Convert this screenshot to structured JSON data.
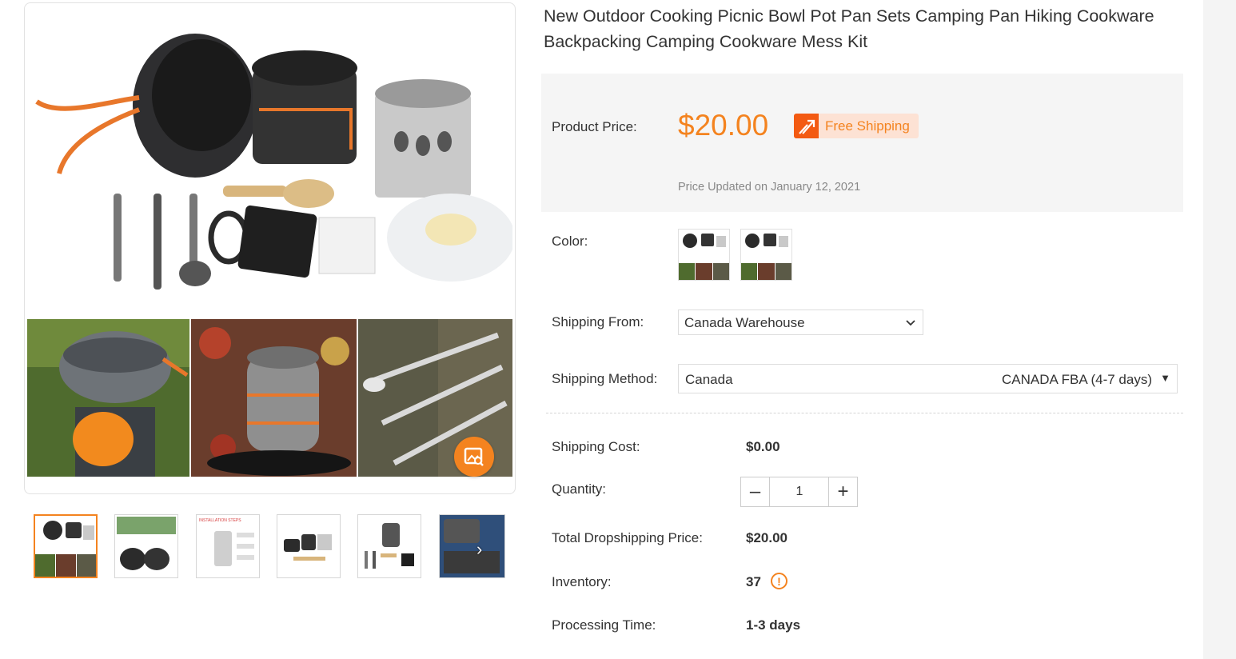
{
  "product": {
    "title": "New Outdoor Cooking Picnic Bowl Pot Pan Sets Camping Pan Hiking Cookware Backpacking Camping Cookware Mess Kit"
  },
  "price_box": {
    "label": "Product Price:",
    "price": "$20.00",
    "free_shipping": "Free Shipping",
    "updated": "Price Updated on January 12, 2021"
  },
  "color": {
    "label": "Color:",
    "swatches": [
      "Color option 1",
      "Color option 2"
    ]
  },
  "shipping_from": {
    "label": "Shipping From:",
    "value": "Canada Warehouse"
  },
  "shipping_method": {
    "label": "Shipping Method:",
    "country": "Canada",
    "option": "CANADA FBA (4-7 days)"
  },
  "shipping_cost": {
    "label": "Shipping Cost:",
    "value": "$0.00"
  },
  "quantity": {
    "label": "Quantity:",
    "value": "1",
    "minus": "–",
    "plus": "+"
  },
  "total": {
    "label": "Total Dropshipping Price:",
    "value": "$20.00"
  },
  "inventory": {
    "label": "Inventory:",
    "value": "37"
  },
  "processing": {
    "label": "Processing Time:",
    "value": "1-3 days"
  },
  "gallery": {
    "thumb_labels": [
      "INSTALLATION STEPS"
    ]
  },
  "colors": {
    "accent": "#f4831f",
    "free_ship_bg": "#fde2d4",
    "free_ship_icon_bg": "#f35a12",
    "price_box_bg": "#f5f5f5"
  },
  "icons": [
    "image-search-icon",
    "truck-icon",
    "chevron-down-icon",
    "caret-down-icon",
    "chevron-right-icon",
    "info-icon",
    "minus-icon",
    "plus-icon"
  ]
}
